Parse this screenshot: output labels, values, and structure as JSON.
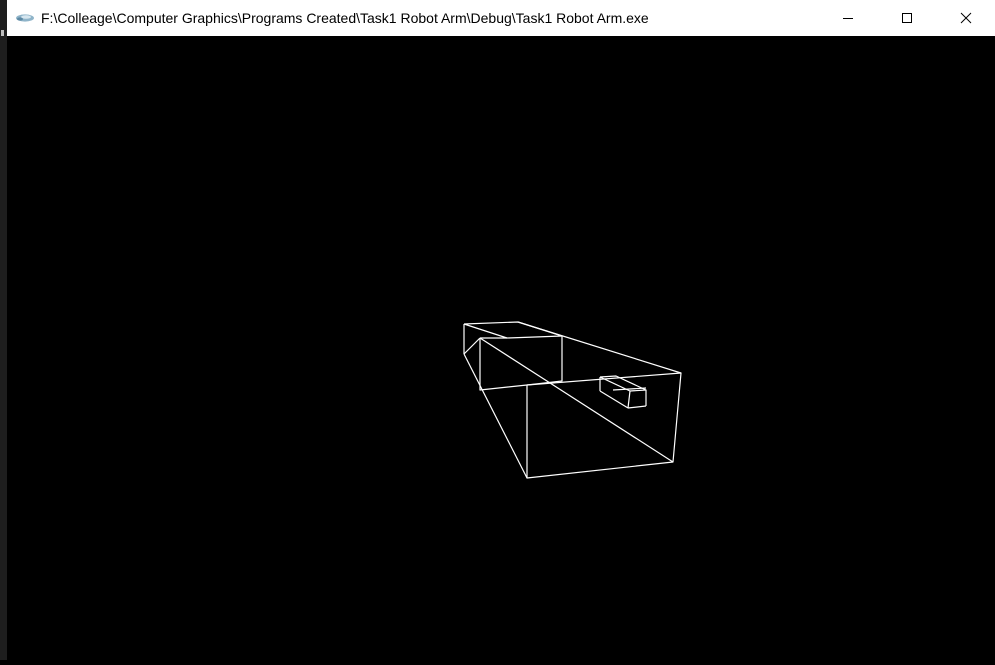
{
  "window": {
    "title": "F:\\Colleage\\Computer Graphics\\Programs Created\\Task1 Robot Arm\\Debug\\Task1 Robot Arm.exe",
    "app_icon": "visual-studio-app-icon",
    "controls": {
      "minimize_icon": "minimize-icon",
      "maximize_icon": "maximize-icon",
      "close_icon": "close-icon"
    }
  },
  "scene": {
    "background_color": "#000000",
    "line_color": "#ffffff",
    "objects": [
      "robot-arm-base-wireframe",
      "robot-arm-gripper-wireframe"
    ]
  }
}
